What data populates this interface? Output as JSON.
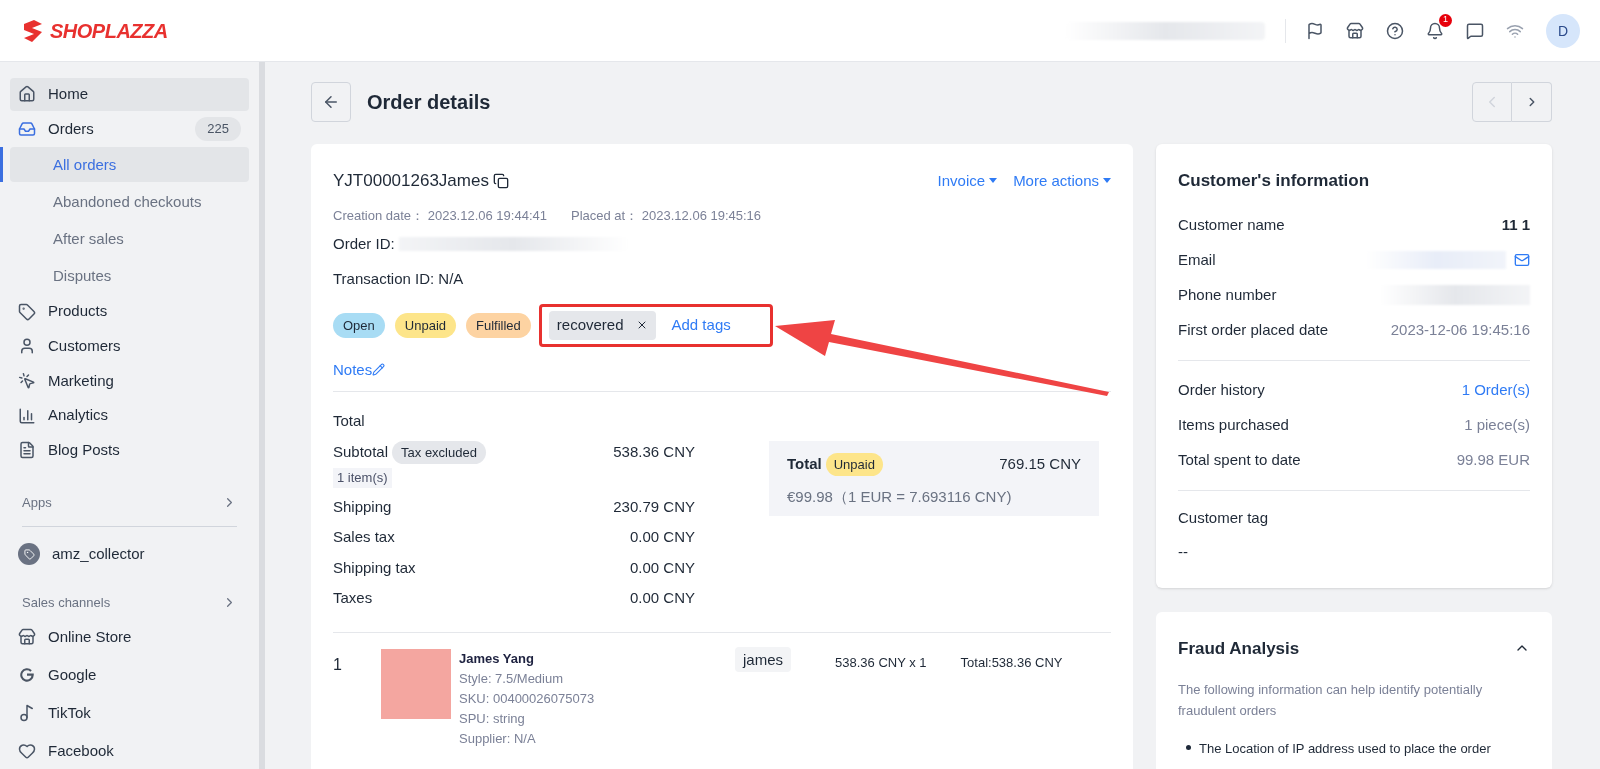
{
  "header": {
    "logo": "SHOPLAZZA",
    "notification_count": "1",
    "avatar": "D"
  },
  "sidebar": {
    "items": [
      {
        "label": "Home",
        "selected": true
      },
      {
        "label": "Orders",
        "selected": false,
        "count": "225",
        "children": [
          {
            "label": "All orders",
            "selected": true
          },
          {
            "label": "Abandoned checkouts",
            "selected": false
          },
          {
            "label": "After sales",
            "selected": false
          },
          {
            "label": "Disputes",
            "selected": false
          }
        ]
      },
      {
        "label": "Products",
        "selected": false
      },
      {
        "label": "Customers",
        "selected": false
      },
      {
        "label": "Marketing",
        "selected": false
      },
      {
        "label": "Analytics",
        "selected": false
      },
      {
        "label": "Blog Posts",
        "selected": false
      }
    ],
    "apps_heading": "Apps",
    "apps": [
      "amz_collector"
    ],
    "channels_heading": "Sales channels",
    "channels": [
      "Online Store",
      "Google",
      "TikTok",
      "Facebook"
    ]
  },
  "page": {
    "title": "Order details"
  },
  "order": {
    "number": "YJT00001263James",
    "actions": [
      "Invoice",
      "More actions"
    ],
    "creation_label": "Creation date：",
    "creation_date": "2023.12.06 19:44:41",
    "placed_label": "Placed at：",
    "placed_date": "2023.12.06 19:45:16",
    "order_id_label": "Order ID:",
    "transaction": "Transaction ID: N/A",
    "statuses": [
      {
        "label": "Open",
        "color": "#a8dcf4"
      },
      {
        "label": "Unpaid",
        "color": "#fde58a"
      },
      {
        "label": "Fulfilled",
        "color": "#fdd3a2"
      }
    ],
    "tags": [
      "recovered"
    ],
    "add_tags": "Add tags",
    "notes": "Notes",
    "total_heading": "Total",
    "lines": [
      {
        "label": "Subtotal",
        "badge": "Tax excluded",
        "note": "1 item(s)",
        "value": "538.36 CNY"
      },
      {
        "label": "Shipping",
        "value": "230.79 CNY"
      },
      {
        "label": "Sales tax",
        "value": "0.00 CNY"
      },
      {
        "label": "Shipping tax",
        "value": "0.00 CNY"
      },
      {
        "label": "Taxes",
        "value": "0.00 CNY"
      }
    ],
    "summary": {
      "label": "Total",
      "badge": "Unpaid",
      "value": "769.15 CNY",
      "converted": "€99.98（1 EUR = 7.693116 CNY)"
    },
    "items": [
      {
        "index": "1",
        "name": "James Yang",
        "details": [
          "Style: 7.5/Medium",
          "SKU: 00400026075073",
          "SPU: string",
          "Supplier: N/A"
        ],
        "tag": "james",
        "price": "538.36 CNY x 1",
        "total": "Total:538.36 CNY"
      }
    ]
  },
  "customer": {
    "title": "Customer's information",
    "rows": [
      {
        "label": "Customer name",
        "value": "11 1",
        "kind": "bold"
      },
      {
        "label": "Email",
        "kind": "email"
      },
      {
        "label": "Phone number",
        "kind": "hidden"
      },
      {
        "label": "First order placed date",
        "value": "2023-12-06 19:45:16",
        "kind": "muted"
      }
    ],
    "stats": [
      {
        "label": "Order history",
        "value": "1 Order(s)",
        "kind": "link"
      },
      {
        "label": "Items purchased",
        "value": "1 piece(s)",
        "kind": "muted"
      },
      {
        "label": "Total spent to date",
        "value": "99.98 EUR",
        "kind": "muted"
      }
    ],
    "tag_label": "Customer tag",
    "tag_value": "--"
  },
  "fraud": {
    "title": "Fraud Analysis",
    "expanded": true,
    "intro": "The following information can help identify potentially fraudulent orders",
    "bullets": [
      "The Location of IP address used to place the order"
    ]
  }
}
